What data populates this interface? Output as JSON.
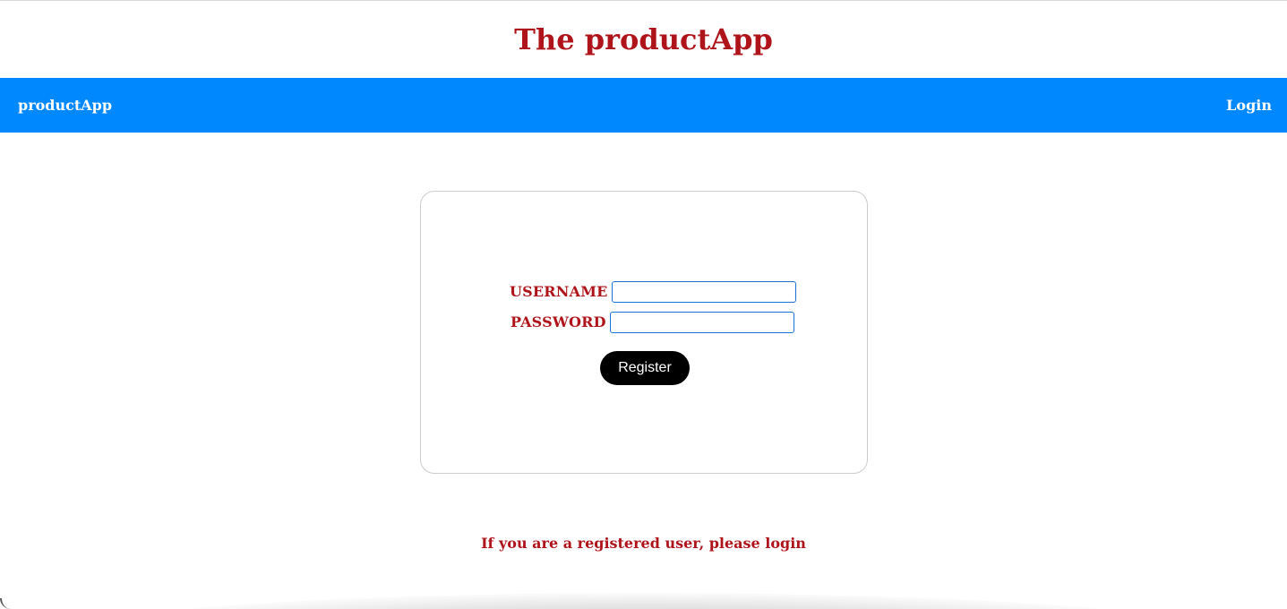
{
  "header": {
    "title": "The productApp"
  },
  "navbar": {
    "brand": "productApp",
    "login_link": "Login",
    "background": "#0088ff"
  },
  "form": {
    "username_label": "USERNAME",
    "username_value": "",
    "password_label": "PASSWORD",
    "password_value": "",
    "register_label": "Register"
  },
  "footer": {
    "login_hint": "If you are a registered user, please login"
  },
  "colors": {
    "accent": "#b0141b",
    "button": "#000000"
  }
}
